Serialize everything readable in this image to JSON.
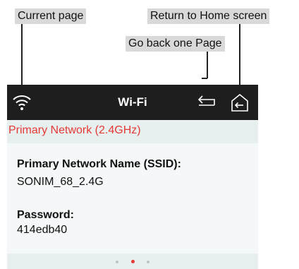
{
  "callouts": {
    "current_page": "Current page",
    "return_home": "Return to Home screen",
    "go_back": "Go back one Page"
  },
  "topbar": {
    "title": "Wi-Fi",
    "icons": [
      "wifi-icon",
      "back-arrow-icon",
      "home-back-icon"
    ]
  },
  "section": {
    "header": "Primary Network (2.4GHz)"
  },
  "network": {
    "ssid_label": "Primary Network Name (SSID):",
    "ssid_value": "SONIM_68_2.4G",
    "password_label": "Password:",
    "password_value": "414edb40"
  },
  "pager": {
    "total_pages": 3,
    "active_index": 1
  },
  "colors": {
    "accent": "#e53935",
    "topbar": "#1e1e1e",
    "background": "#e7efef"
  }
}
